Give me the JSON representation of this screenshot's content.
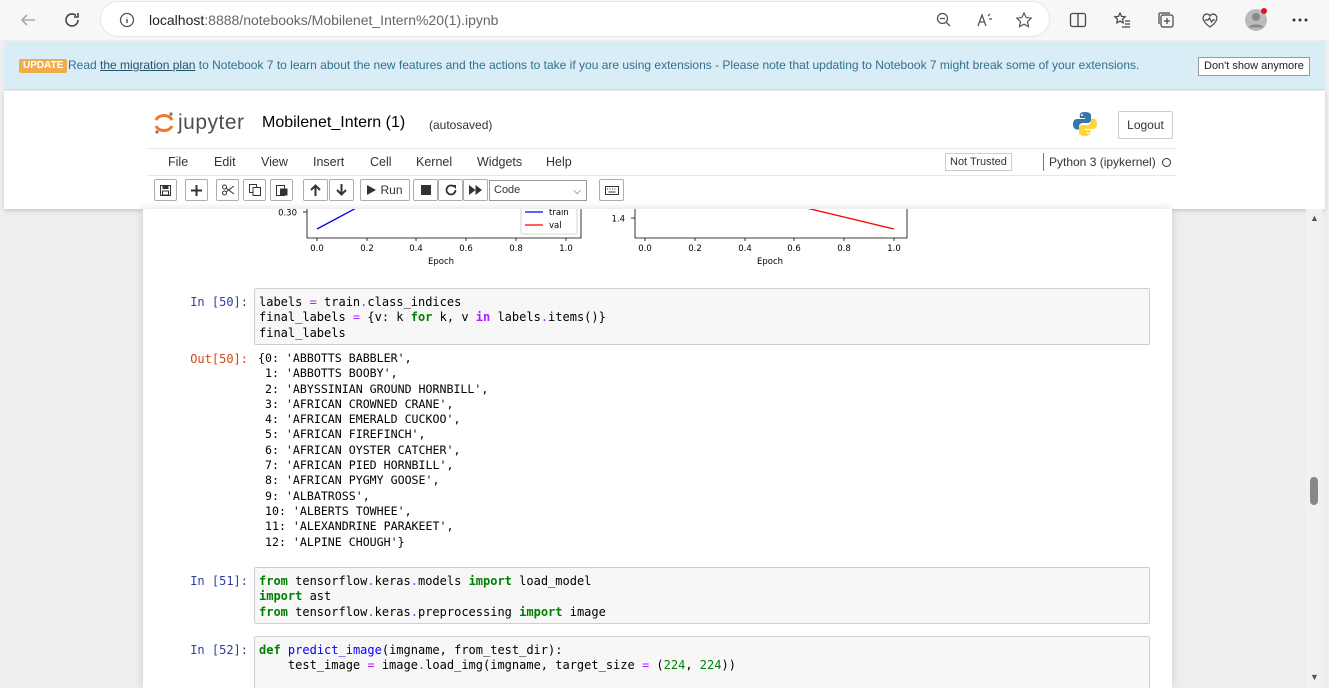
{
  "browser": {
    "url_host": "localhost",
    "url_path": ":8888/notebooks/Mobilenet_Intern%20(1).ipynb"
  },
  "banner": {
    "badge": "UPDATE",
    "msg_prefix": "Read",
    "link": "the migration plan",
    "msg_suffix": "to Notebook 7 to learn about the new features and the actions to take if you are using extensions - Please note that updating to Notebook 7 might break some of your extensions.",
    "dismiss_label": "Don't show anymore"
  },
  "header": {
    "logo_text": "jupyter",
    "notebook_title": "Mobilenet_Intern (1)",
    "autosave_status": "(autosaved)",
    "logout_label": "Logout"
  },
  "menu": {
    "items": [
      "File",
      "Edit",
      "View",
      "Insert",
      "Cell",
      "Kernel",
      "Widgets",
      "Help"
    ],
    "trust_label": "Not Trusted",
    "kernel_label": "Python 3 (ipykernel)"
  },
  "toolbar": {
    "run_label": "Run",
    "cell_type": "Code"
  },
  "plots": {
    "left": {
      "ytick": "0.30",
      "xticks": [
        "0.0",
        "0.2",
        "0.4",
        "0.6",
        "0.8",
        "1.0"
      ],
      "xlabel": "Epoch",
      "legend": [
        "train",
        "val"
      ]
    },
    "right": {
      "ytick": "1.4",
      "xticks": [
        "0.0",
        "0.2",
        "0.4",
        "0.6",
        "0.8",
        "1.0"
      ],
      "xlabel": "Epoch"
    },
    "colors": {
      "train": "#0000ff",
      "val": "#ff0000"
    }
  },
  "cells": {
    "c50": {
      "in_prompt": "In [50]:",
      "out_prompt": "Out[50]:",
      "output_lines": [
        "{0: 'ABBOTTS BABBLER',",
        " 1: 'ABBOTTS BOOBY',",
        " 2: 'ABYSSINIAN GROUND HORNBILL',",
        " 3: 'AFRICAN CROWNED CRANE',",
        " 4: 'AFRICAN EMERALD CUCKOO',",
        " 5: 'AFRICAN FIREFINCH',",
        " 6: 'AFRICAN OYSTER CATCHER',",
        " 7: 'AFRICAN PIED HORNBILL',",
        " 8: 'AFRICAN PYGMY GOOSE',",
        " 9: 'ALBATROSS',",
        " 10: 'ALBERTS TOWHEE',",
        " 11: 'ALEXANDRINE PARAKEET',",
        " 12: 'ALPINE CHOUGH'}"
      ]
    },
    "c51": {
      "in_prompt": "In [51]:"
    },
    "c52": {
      "in_prompt": "In [52]:"
    }
  }
}
